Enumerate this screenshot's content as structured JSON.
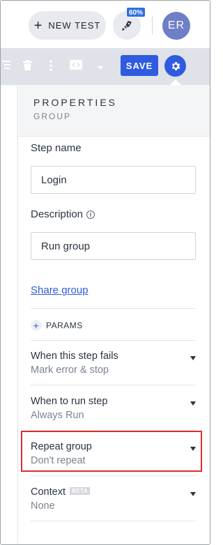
{
  "topbar": {
    "new_test_label": "NEW TEST",
    "new_test_icon": "plus-icon",
    "rocket_icon": "rocket-icon",
    "progress_badge": "60%",
    "avatar_initials": "ER"
  },
  "toolbar": {
    "icons": [
      "group-icon",
      "trash-icon",
      "more-vertical-icon",
      "code-icon",
      "caret-down-icon"
    ],
    "save_label": "SAVE",
    "gear_icon": "gear-icon",
    "accent": "#2f5be0"
  },
  "panel": {
    "title": "PROPERTIES",
    "subtitle": "GROUP",
    "step_name_label": "Step name",
    "step_name_value": "Login",
    "description_label": "Description",
    "description_value": "Run group",
    "share_link": "Share group",
    "params_label": "PARAMS",
    "settings": [
      {
        "label": "When this step fails",
        "value": "Mark error & stop"
      },
      {
        "label": "When to run step",
        "value": "Always Run"
      },
      {
        "label": "Repeat group",
        "value": "Don't repeat"
      },
      {
        "label": "Context",
        "badge": "BETA",
        "value": "None"
      }
    ],
    "highlight_color": "#e02c2c"
  }
}
